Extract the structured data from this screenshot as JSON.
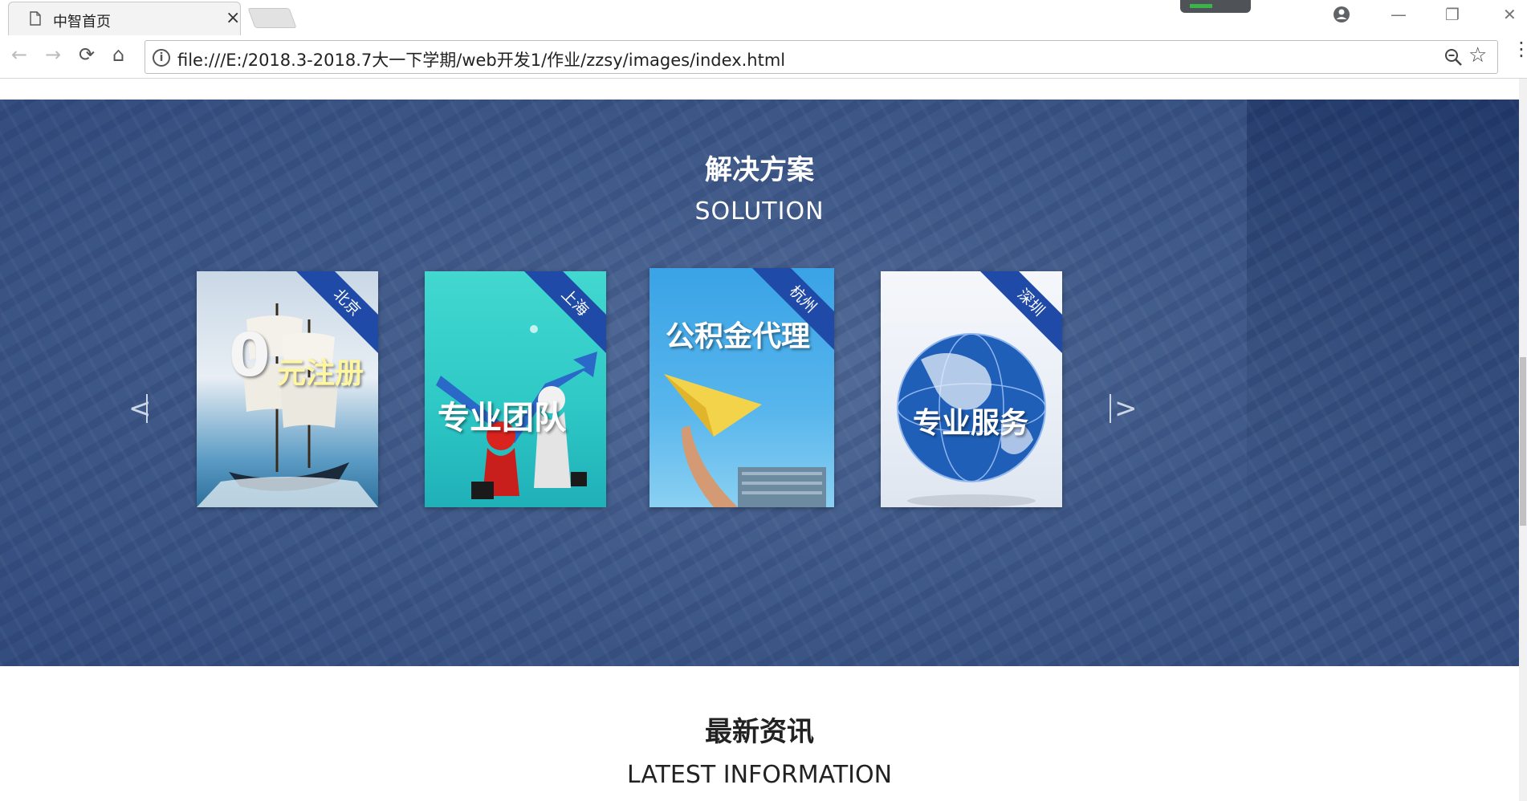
{
  "browser": {
    "tab_title": "中智首页",
    "tab_close": "×",
    "url": "file:///E:/2018.3-2018.7大一下学期/web开发1/作业/zzsy/images/index.html",
    "info_glyph": "i",
    "back": "←",
    "forward": "→",
    "reload": "⟳",
    "home": "⌂",
    "star": "☆",
    "menu": "⋮",
    "minimize": "—",
    "restore": "❐",
    "close": "✕"
  },
  "solution": {
    "title": "解决方案",
    "subtitle": "SOLUTION",
    "prev_arrow": "<",
    "next_arrow": ">",
    "cards": [
      {
        "city": "北京",
        "caption_big": "0",
        "caption": "元注册",
        "icon": "sailing-ship-image"
      },
      {
        "city": "上海",
        "caption": "专业团队",
        "icon": "handshake-arrow-image"
      },
      {
        "city": "杭州",
        "caption": "公积金代理",
        "icon": "paper-plane-image"
      },
      {
        "city": "深圳",
        "caption": "专业服务",
        "icon": "globe-image"
      }
    ]
  },
  "news": {
    "title": "最新资讯",
    "subtitle": "LATEST INFORMATION"
  },
  "colors": {
    "banner_base": "#45608f",
    "ribbon": "#1f4aa7",
    "card2_bg": "#2fc9c6",
    "card3_bg": "#3aa3e6",
    "card4_bg": "#e9eef6"
  }
}
